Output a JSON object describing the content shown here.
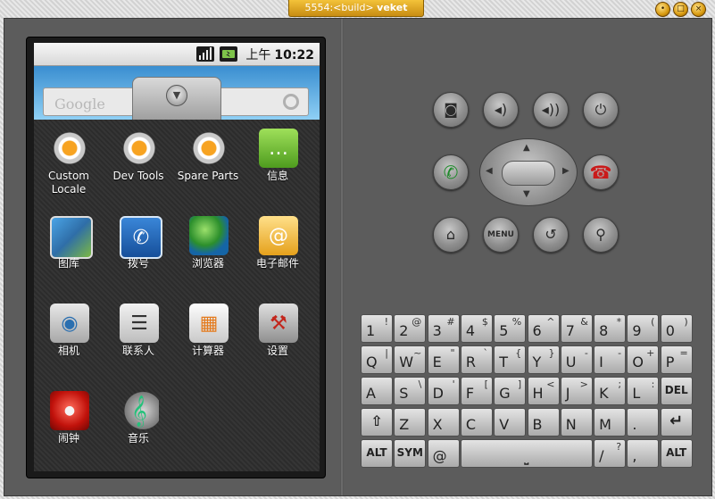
{
  "window": {
    "title_port": "5554:<build>",
    "title_name": "veket"
  },
  "statusbar": {
    "ampm": "上午",
    "time": "10:22"
  },
  "search": {
    "placeholder": "Google"
  },
  "apps": [
    {
      "label": "Custom\nLocale",
      "icon": "custom-locale-icon"
    },
    {
      "label": "Dev Tools",
      "icon": "dev-tools-icon"
    },
    {
      "label": "Spare Parts",
      "icon": "spare-parts-icon"
    },
    {
      "label": "信息",
      "icon": "messaging-icon"
    },
    {
      "label": "图库",
      "icon": "gallery-icon"
    },
    {
      "label": "拨号",
      "icon": "dialer-icon"
    },
    {
      "label": "浏览器",
      "icon": "browser-icon"
    },
    {
      "label": "电子邮件",
      "icon": "email-icon"
    },
    {
      "label": "相机",
      "icon": "camera-icon"
    },
    {
      "label": "联系人",
      "icon": "contacts-icon"
    },
    {
      "label": "计算器",
      "icon": "calculator-icon"
    },
    {
      "label": "设置",
      "icon": "settings-icon"
    },
    {
      "label": "闹钟",
      "icon": "alarm-icon"
    },
    {
      "label": "音乐",
      "icon": "music-icon"
    }
  ],
  "controls": {
    "menu_label": "MENU"
  },
  "keyboard": {
    "row1": [
      [
        "1",
        "!"
      ],
      [
        "2",
        "@"
      ],
      [
        "3",
        "#"
      ],
      [
        "4",
        "$"
      ],
      [
        "5",
        "%"
      ],
      [
        "6",
        "^"
      ],
      [
        "7",
        "&"
      ],
      [
        "8",
        "*"
      ],
      [
        "9",
        "("
      ],
      [
        "0",
        ")"
      ]
    ],
    "row2": [
      [
        "Q",
        "|"
      ],
      [
        "W",
        "~"
      ],
      [
        "E",
        "\""
      ],
      [
        "R",
        "`"
      ],
      [
        "T",
        "{"
      ],
      [
        "Y",
        "}"
      ],
      [
        "U",
        "-"
      ],
      [
        "I",
        "-"
      ],
      [
        "O",
        "+"
      ],
      [
        "P",
        "="
      ]
    ],
    "row3": [
      [
        "A",
        ""
      ],
      [
        "S",
        "\\"
      ],
      [
        "D",
        "'"
      ],
      [
        "F",
        "["
      ],
      [
        "G",
        "]"
      ],
      [
        "H",
        "<"
      ],
      [
        "J",
        ">"
      ],
      [
        "K",
        ";"
      ],
      [
        "L",
        ":"
      ]
    ],
    "row4": [
      [
        "Z",
        ""
      ],
      [
        "X",
        ""
      ],
      [
        "C",
        ""
      ],
      [
        "V",
        ""
      ],
      [
        "B",
        ""
      ],
      [
        "N",
        ""
      ],
      [
        "M",
        ""
      ],
      [
        ".",
        ""
      ]
    ],
    "del_label": "DEL",
    "alt_label": "ALT",
    "sym_label": "SYM",
    "at_label": "@",
    "slash_label": "/",
    "question_label": "?",
    "comma_label": ","
  }
}
